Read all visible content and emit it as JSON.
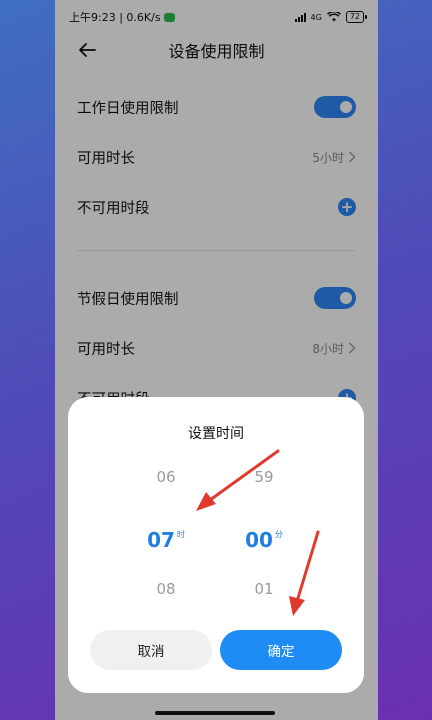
{
  "status_bar": {
    "time_speed": "上午9:23 | 0.6K/s",
    "signal": "4G",
    "battery": "72"
  },
  "header": {
    "title": "设备使用限制"
  },
  "workday": {
    "limit_label": "工作日使用限制",
    "available_label": "可用时长",
    "available_value": "5小时",
    "unavailable_label": "不可用时段"
  },
  "holiday": {
    "limit_label": "节假日使用限制",
    "available_label": "可用时长",
    "available_value": "8小时",
    "unavailable_label": "不可用时段"
  },
  "dialog": {
    "title": "设置时间",
    "hours": {
      "prev": "06",
      "selected": "07",
      "unit": "时",
      "next": "08"
    },
    "minutes": {
      "prev": "59",
      "selected": "00",
      "unit": "分",
      "next": "01"
    },
    "cancel_label": "取消",
    "confirm_label": "确定"
  },
  "colors": {
    "accent": "#2f86f6",
    "selected_text": "#1f7fe0",
    "annotation_arrow": "#e03a2d"
  }
}
